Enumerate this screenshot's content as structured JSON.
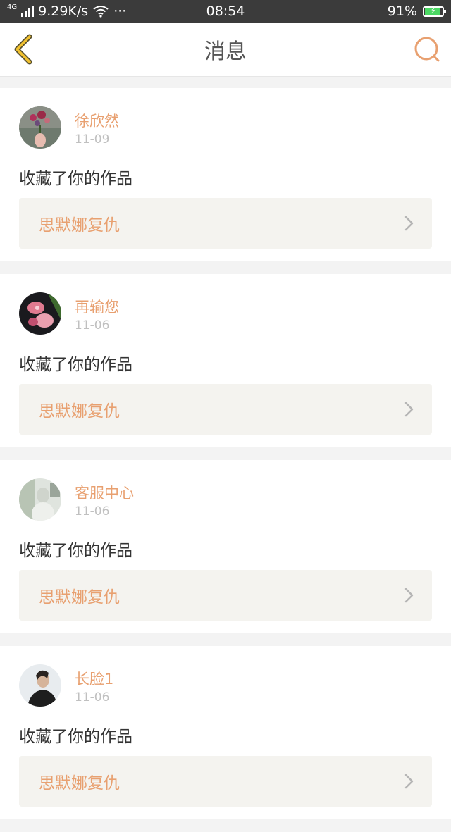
{
  "status_bar": {
    "network_type": "4G",
    "speed": "9.29K/s",
    "more": "···",
    "time": "08:54",
    "battery_percent": "91%",
    "battery_level": 0.91,
    "battery_color": "#4cd964"
  },
  "nav": {
    "title": "消息",
    "back_icon": "back-chevron-icon",
    "search_icon": "search-icon",
    "accent_color": "#e8a070",
    "back_color": "#f2c230"
  },
  "messages": [
    {
      "user": "徐欣然",
      "date": "11-09",
      "action": "收藏了你的作品",
      "work_title": "思默娜复仇",
      "avatar": "vase-flowers-avatar"
    },
    {
      "user": "再输您",
      "date": "11-06",
      "action": "收藏了你的作品",
      "work_title": "思默娜复仇",
      "avatar": "pink-flowers-avatar"
    },
    {
      "user": "客服中心",
      "date": "11-06",
      "action": "收藏了你的作品",
      "work_title": "思默娜复仇",
      "avatar": "blurred-photo-avatar"
    },
    {
      "user": "长脸1",
      "date": "11-06",
      "action": "收藏了你的作品",
      "work_title": "思默娜复仇",
      "avatar": "person-avatar"
    }
  ]
}
